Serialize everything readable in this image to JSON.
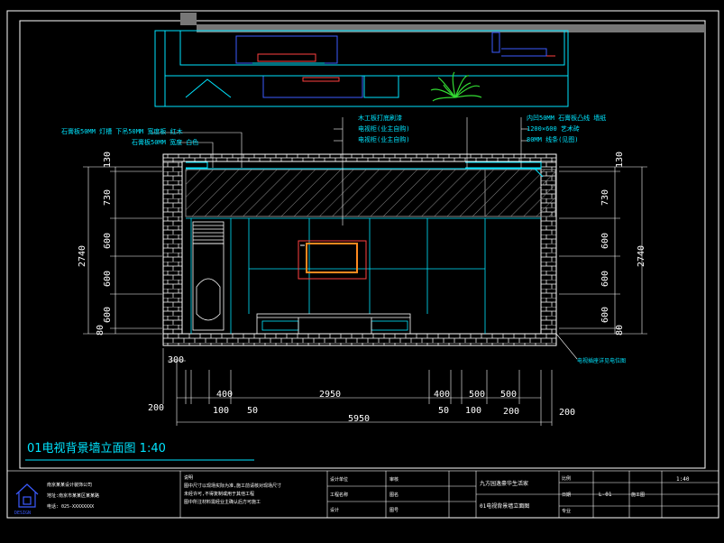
{
  "drawing": {
    "title": "01电视背景墙立面图 1:40",
    "sheet_title": "01电视背景墙立面图",
    "project": "九方园逸豪华生活家",
    "drawing_no": "L-01",
    "scale": "1:40"
  },
  "annotations_left": [
    "石膏板50MM 灯槽 下吊50MM 宽度板 红木",
    "石膏板50MM 宽度 白色"
  ],
  "annotations_center": [
    "木工板打底刷漆",
    "电视柜(业主自购)",
    "电视柜(业主自购)"
  ],
  "annotations_right": [
    "内凹50MM 石膏板凸线 墙纸",
    "1200×600 艺术砖",
    "80MM 线条(见图)"
  ],
  "note_bottom_right": "电视插座详见电位图",
  "dims_left_vertical": [
    "130",
    "730",
    "600",
    "600",
    "600",
    "80"
  ],
  "dims_left_total": "2740",
  "dims_right_vertical": [
    "130",
    "730",
    "600",
    "600",
    "600",
    "80"
  ],
  "dims_right_total": "2740",
  "dims_bottom_row1": [
    "300",
    "400",
    "2950",
    "400",
    "500",
    "500"
  ],
  "dims_bottom_row2": [
    "200",
    "100",
    "50",
    "50",
    "100",
    "200",
    "200"
  ],
  "dims_bottom_total": "5950",
  "title_block": {
    "company_lines": [
      "南京某某设计装饰公司",
      "地址:南京市某某区某某路",
      "电话: 025-XXXXXXXX"
    ],
    "notes_header": "说明",
    "notes_lines": [
      "图中尺寸以现场实际为准,施工前请核对现场尺寸",
      "未经许可,不得复制或用于其他工程",
      "图中所注材料需经业主确认后方可施工"
    ],
    "labels": [
      "设计单位",
      "工程名称",
      "设计",
      "审核",
      "图名",
      "图号",
      "比例",
      "日期",
      "专业",
      "施工图"
    ],
    "values": [
      "1:40",
      "L-01"
    ]
  },
  "colors": {
    "bg": "#000000",
    "frame": "#ffffff",
    "cyan": "#00e5ff",
    "blue": "#3b5bff",
    "yellow": "#ffff33",
    "red": "#ff4040",
    "orange": "#ff8a1f",
    "green": "#33dd33",
    "grey": "#888888"
  }
}
